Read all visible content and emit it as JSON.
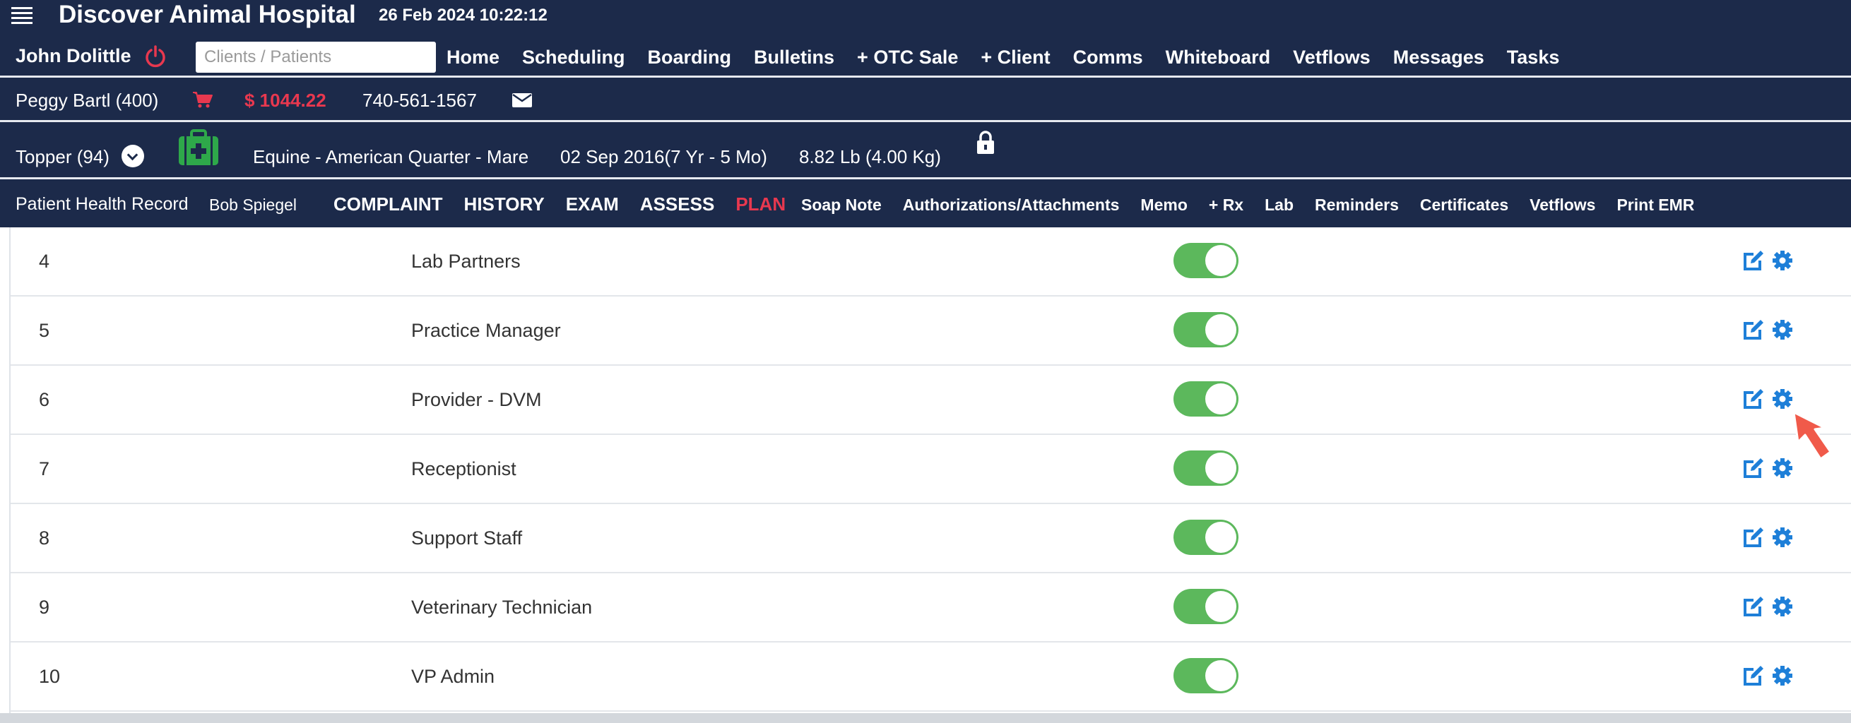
{
  "header": {
    "app_title": "Discover Animal Hospital",
    "datetime": "26 Feb 2024 10:22:12",
    "user_name": "John Dolittle",
    "search_placeholder": "Clients / Patients",
    "nav": [
      "Home",
      "Scheduling",
      "Boarding",
      "Bulletins",
      "+ OTC Sale",
      "+ Client",
      "Comms",
      "Whiteboard",
      "Vetflows",
      "Messages",
      "Tasks"
    ]
  },
  "client": {
    "name": "Peggy Bartl (400)",
    "balance": "$ 1044.22",
    "phone": "740-561-1567"
  },
  "patient": {
    "name": "Topper (94)",
    "species": "Equine - American Quarter - Mare",
    "dob": "02 Sep 2016(7 Yr - 5 Mo)",
    "weight": "8.82 Lb (4.00 Kg)"
  },
  "record_bar": {
    "label": "Patient Health Record",
    "user": "Bob Spiegel",
    "soap_tabs": [
      "COMPLAINT",
      "HISTORY",
      "EXAM",
      "ASSESS",
      "PLAN"
    ],
    "active_tab": "PLAN",
    "links": [
      "Soap Note",
      "Authorizations/Attachments",
      "Memo",
      "+ Rx",
      "Lab",
      "Reminders",
      "Certificates",
      "Vetflows",
      "Print EMR"
    ]
  },
  "roles_table": {
    "rows": [
      {
        "num": "4",
        "role": "Lab Partners",
        "enabled": true
      },
      {
        "num": "5",
        "role": "Practice Manager",
        "enabled": true
      },
      {
        "num": "6",
        "role": "Provider - DVM",
        "enabled": true
      },
      {
        "num": "7",
        "role": "Receptionist",
        "enabled": true
      },
      {
        "num": "8",
        "role": "Support Staff",
        "enabled": true
      },
      {
        "num": "9",
        "role": "Veterinary Technician",
        "enabled": true
      },
      {
        "num": "10",
        "role": "VP Admin",
        "enabled": true
      }
    ]
  },
  "colors": {
    "header_bg": "#1c2a4a",
    "accent_red": "#e8384f",
    "toggle_on": "#5cb85c",
    "icon_blue": "#1e7fd8",
    "medkit_green": "#2ea84a",
    "cursor_red": "#f05a4a"
  }
}
